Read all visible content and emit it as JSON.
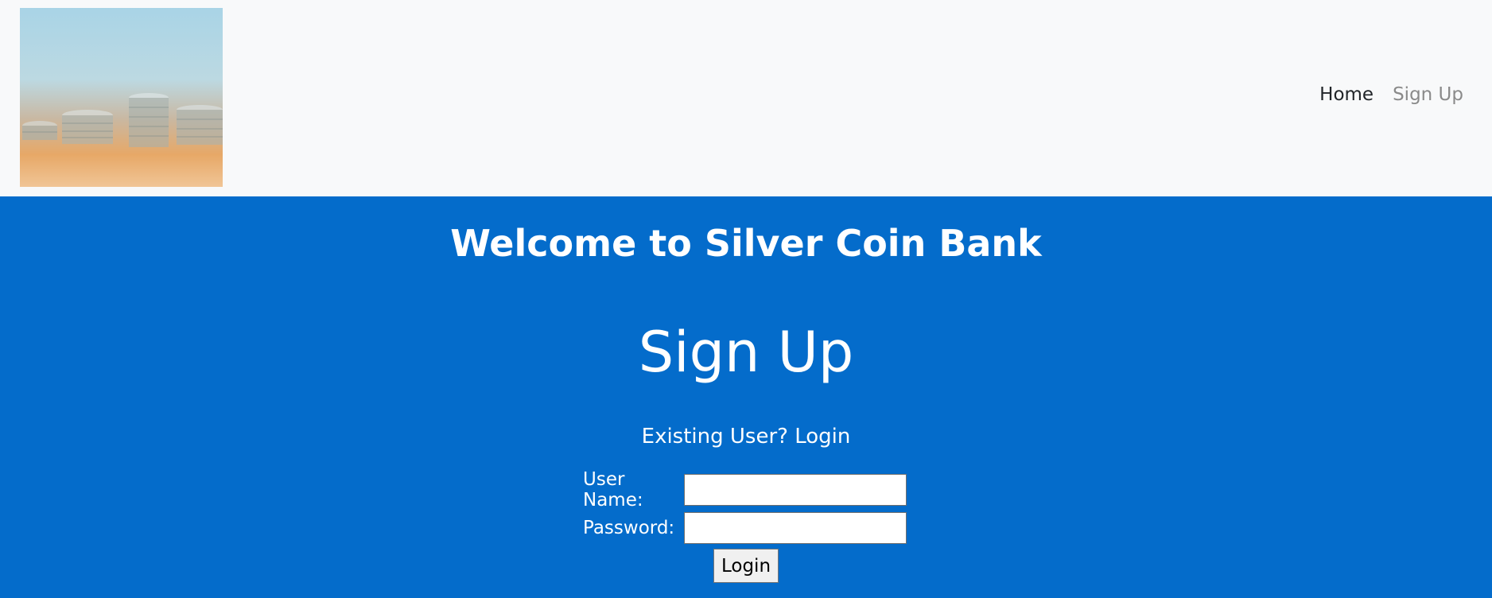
{
  "nav": {
    "logo_alt": "coin stacks",
    "home_label": "Home",
    "signup_label": "Sign Up"
  },
  "hero": {
    "welcome": "Welcome to Silver Coin Bank",
    "title": "Sign Up",
    "existing_user": "Existing User? Login"
  },
  "form": {
    "username_label": "User Name:",
    "username_value": "",
    "password_label": "Password:",
    "password_value": "",
    "submit_label": "Login"
  },
  "colors": {
    "navbar_bg": "#f8f9fa",
    "hero_bg": "#046ccb",
    "nav_active": "#212529",
    "nav_muted": "#8a8a8a"
  }
}
